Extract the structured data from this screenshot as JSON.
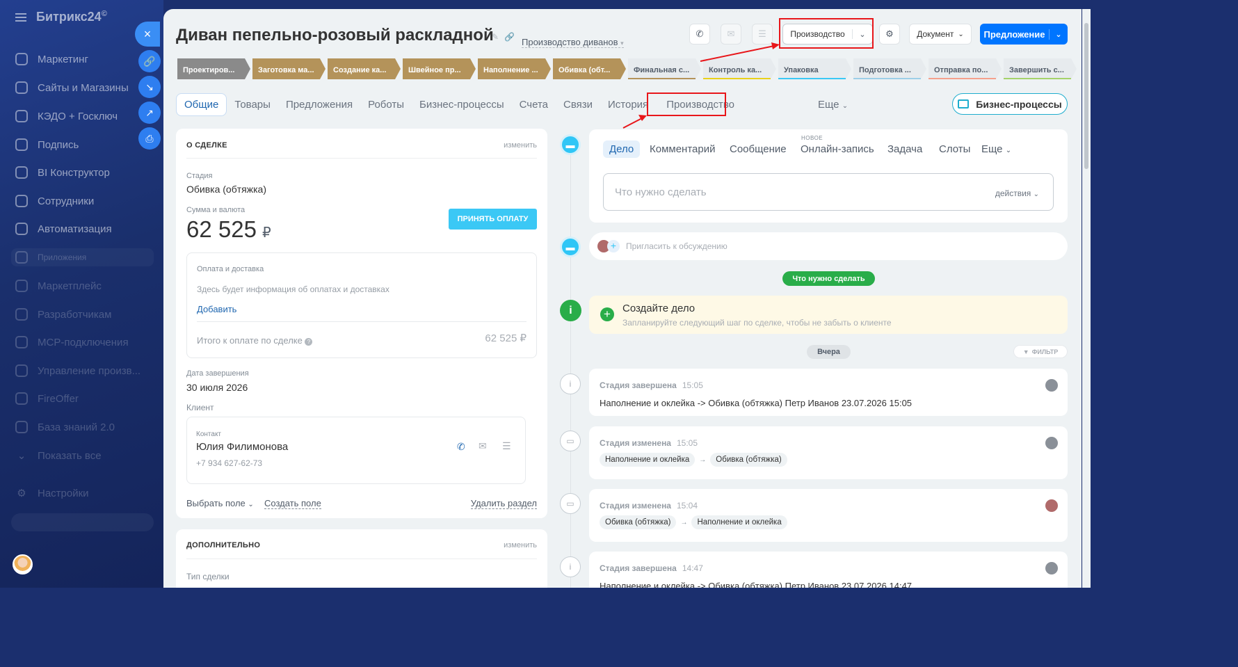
{
  "sidebar": {
    "logo_text": "Битрикс24",
    "logo_mark": "©",
    "items": [
      {
        "label": "Маркетинг",
        "icon": "target-icon"
      },
      {
        "label": "Сайты и Магазины",
        "icon": "cart-icon"
      },
      {
        "label": "КЭДО + Госключ",
        "icon": "doc-icon"
      },
      {
        "label": "Подпись",
        "icon": "pen-icon"
      },
      {
        "label": "BI Конструктор",
        "icon": "bar-chart-icon"
      },
      {
        "label": "Сотрудники",
        "icon": "people-icon"
      },
      {
        "label": "Автоматизация",
        "icon": "robot-icon"
      },
      {
        "label": "Приложения",
        "icon": "cube-icon"
      },
      {
        "label": "Маркетплейс",
        "icon": "marketplace-icon"
      },
      {
        "label": "Разработчикам",
        "icon": "code-icon"
      },
      {
        "label": "MCP-подключения",
        "icon": "mcp-icon"
      },
      {
        "label": "Управление произв...",
        "icon": "app-icon"
      },
      {
        "label": "FireOffer",
        "icon": "app-icon"
      },
      {
        "label": "База знаний 2.0",
        "icon": "book-icon"
      },
      {
        "label": "Показать все",
        "icon": "chevron-down-icon"
      },
      {
        "label": "Настройки",
        "icon": "gear-icon"
      }
    ],
    "close_icon": "×",
    "side_buttons": [
      "link-icon",
      "download-icon",
      "external-icon",
      "print-icon"
    ]
  },
  "header": {
    "title": "Диван пепельно-розовый раскладной",
    "funnel": "Производство диванов",
    "production_button": "Производство",
    "document_button": "Документ",
    "offer_button": "Предложение"
  },
  "stages": [
    {
      "label": "Проектиров...",
      "state": "first"
    },
    {
      "label": "Заготовка ма...",
      "state": "done"
    },
    {
      "label": "Создание ка...",
      "state": "done"
    },
    {
      "label": "Швейное пр...",
      "state": "done"
    },
    {
      "label": "Наполнение ...",
      "state": "done"
    },
    {
      "label": "Обивка (обт...",
      "state": "done"
    },
    {
      "label": "Финальная с...",
      "state": "todo",
      "color": "#b4935a"
    },
    {
      "label": "Контроль ка...",
      "state": "todo",
      "color": "#e9d11a"
    },
    {
      "label": "Упаковка",
      "state": "todo",
      "color": "#3bc8f5"
    },
    {
      "label": "Подготовка ...",
      "state": "todo",
      "color": "#9dcfe8"
    },
    {
      "label": "Отправка по...",
      "state": "todo",
      "color": "#f5a08c"
    },
    {
      "label": "Завершить с...",
      "state": "todo",
      "color": "#a5d36a"
    }
  ],
  "tabs": [
    "Общие",
    "Товары",
    "Предложения",
    "Роботы",
    "Бизнес-процессы",
    "Счета",
    "Связи",
    "История",
    "Производство",
    "Еще"
  ],
  "bp_button": "Бизнес-процессы",
  "deal": {
    "section_title": "О СДЕЛКЕ",
    "edit": "изменить",
    "stage_label": "Стадия",
    "stage_value": "Обивка (обтяжка)",
    "sum_label": "Сумма и валюта",
    "sum_value": "62 525",
    "currency": "₽",
    "pay_button": "ПРИНЯТЬ ОПЛАТУ",
    "payment_title": "Оплата и доставка",
    "payment_hint": "Здесь будет информация об оплатах и доставках",
    "add_link": "Добавить",
    "total_label": "Итого к оплате по сделке",
    "total_value": "62 525 ₽",
    "close_date_label": "Дата завершения",
    "close_date_value": "30 июля 2026",
    "client_label": "Клиент",
    "contact_label": "Контакт",
    "contact_name": "Юлия Филимонова",
    "contact_phone": "+7 934 627-62-73",
    "select_field": "Выбрать поле",
    "create_field": "Создать поле",
    "delete_section": "Удалить раздел"
  },
  "extra": {
    "section_title": "ДОПОЛНИТЕЛЬНО",
    "edit": "изменить",
    "deal_type_label": "Тип сделки"
  },
  "activity": {
    "tabs": [
      "Дело",
      "Комментарий",
      "Сообщение",
      "Онлайн-запись",
      "Задача",
      "Слоты",
      "Еще"
    ],
    "new_badge": "НОВОЕ",
    "placeholder": "Что нужно сделать",
    "actions": "действия",
    "invite": "Пригласить к обсуждению",
    "todo_pill": "Что нужно сделать",
    "create_title": "Создайте дело",
    "create_hint": "Запланируйте следующий шаг по сделке, чтобы не забыть о клиенте",
    "day_pill": "Вчера",
    "filter": "ФИЛЬТР"
  },
  "events": [
    {
      "title": "Стадия завершена",
      "time": "15:05",
      "text": "Наполнение и оклейка -> Обивка (обтяжка) Петр Иванов 23.07.2026 15:05"
    },
    {
      "title": "Стадия изменена",
      "time": "15:05",
      "from": "Наполнение и оклейка",
      "to": "Обивка (обтяжка)"
    },
    {
      "title": "Стадия изменена",
      "time": "15:04",
      "from": "Обивка (обтяжка)",
      "to": "Наполнение и оклейка"
    },
    {
      "title": "Стадия завершена",
      "time": "14:47",
      "text": "Наполнение и оклейка -> Обивка (обтяжка) Петр Иванов 23.07.2026 14:47"
    }
  ],
  "colors": {
    "accent": "#0075ff",
    "highlight": "#e8161a",
    "stage_done": "#b4935a",
    "success": "#29ad49"
  }
}
